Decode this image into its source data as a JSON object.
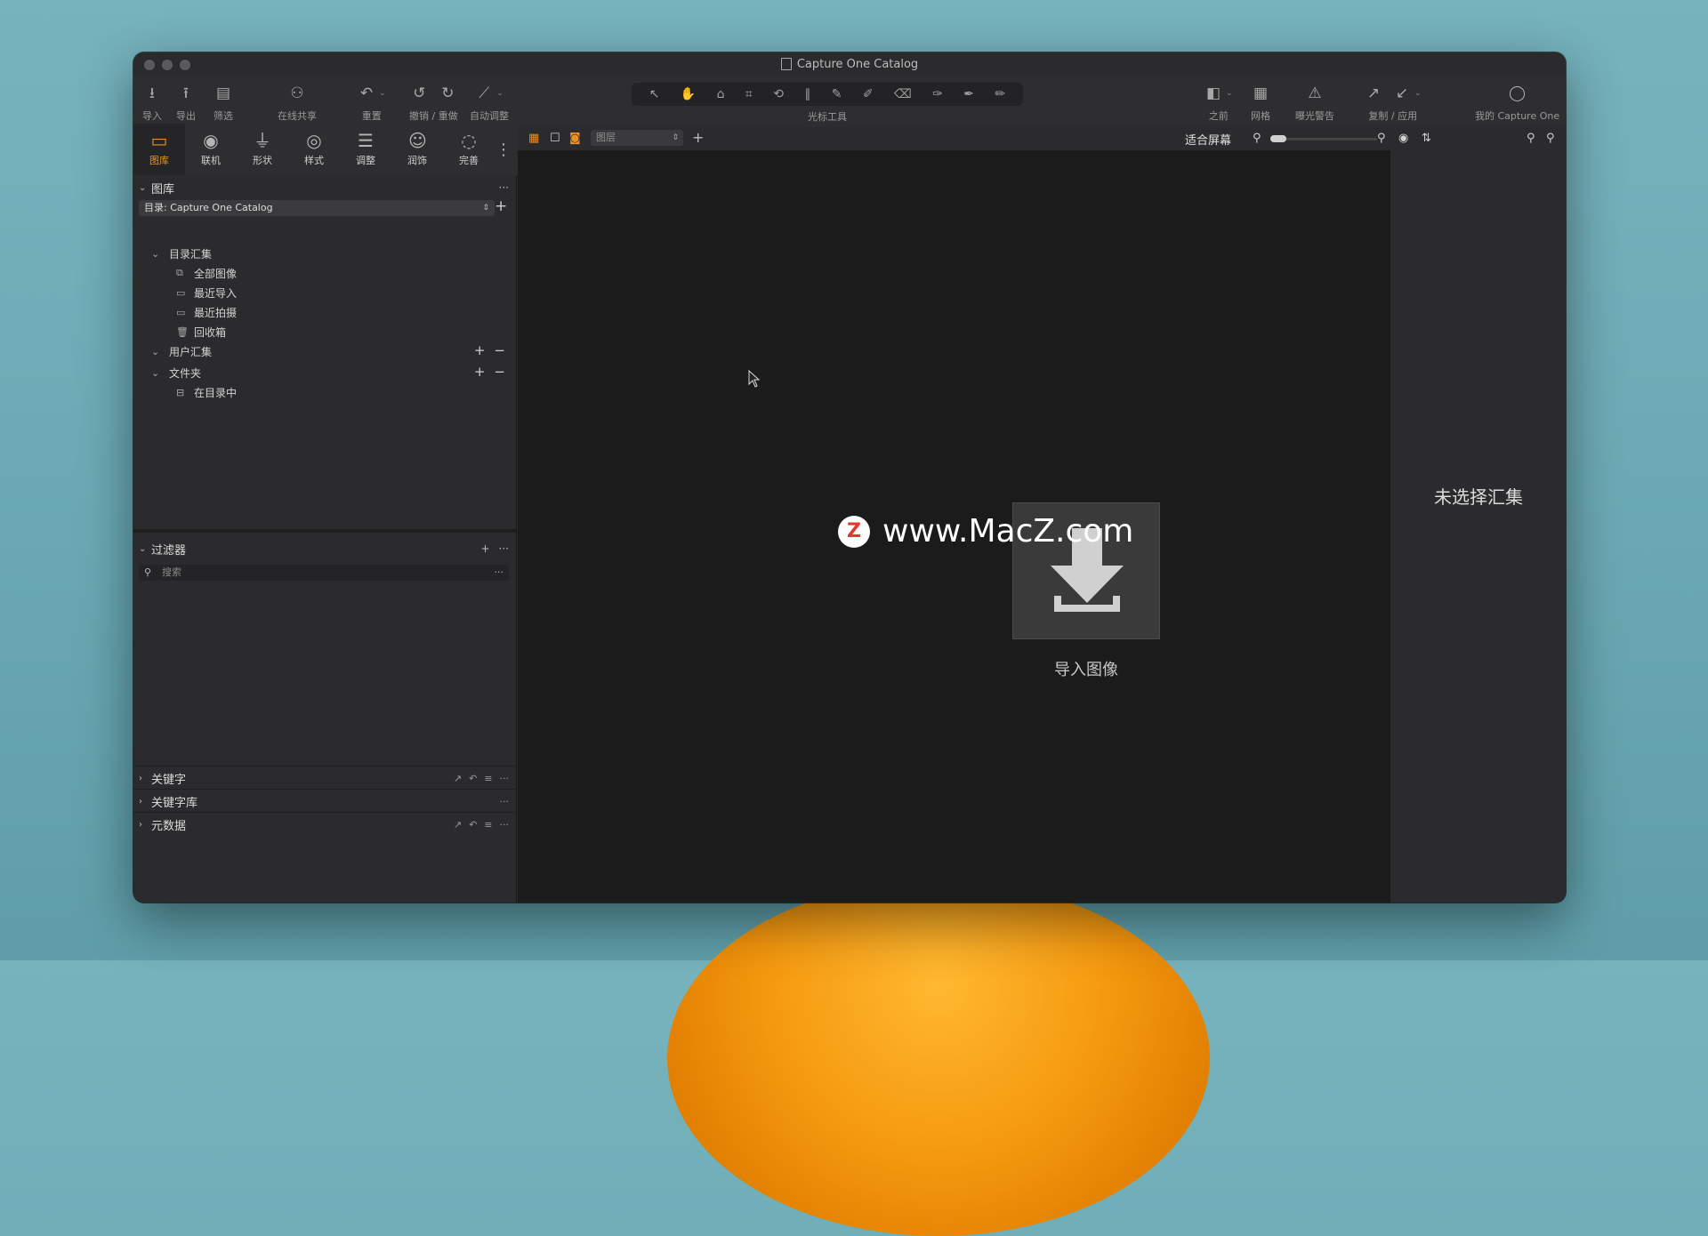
{
  "window": {
    "title": "Capture One Catalog"
  },
  "toolbar": {
    "import": "导入",
    "export": "导出",
    "filter": "筛选",
    "share": "在线共享",
    "reset": "重置",
    "undo_redo": "撤销 / 重做",
    "auto_adjust": "自动调整",
    "cursor_tools": "光标工具",
    "before": "之前",
    "grid": "网格",
    "exposure_warning": "曝光警告",
    "copy_apply": "复制 / 应用",
    "my_capture_one": "我的 Capture One"
  },
  "tabs": [
    {
      "label": "图库",
      "icon": "folder-icon"
    },
    {
      "label": "联机",
      "icon": "camera-icon"
    },
    {
      "label": "形状",
      "icon": "lens-icon"
    },
    {
      "label": "样式",
      "icon": "palette-icon"
    },
    {
      "label": "调整",
      "icon": "sliders-icon"
    },
    {
      "label": "润饰",
      "icon": "face-icon"
    },
    {
      "label": "完善",
      "icon": "circle-dashed-icon"
    }
  ],
  "library": {
    "title": "图库",
    "catalog_select": "目录: Capture One Catalog",
    "catalog_collections": "目录汇集",
    "all_images": "全部图像",
    "recent_imports": "最近导入",
    "recent_captures": "最近拍摄",
    "trash": "回收箱",
    "user_collections": "用户汇集",
    "folders": "文件夹",
    "in_catalog": "在目录中"
  },
  "filters": {
    "title": "过滤器",
    "search_placeholder": "搜索"
  },
  "bottom_sections": {
    "keywords": "关键字",
    "keyword_library": "关键字库",
    "metadata": "元数据"
  },
  "viewer": {
    "layer_select": "图层",
    "fit_screen": "适合屏幕",
    "import_images": "导入图像",
    "watermark": "www.MacZ.com",
    "watermark_logo": "Z"
  },
  "right_panel": {
    "no_collection": "未选择汇集"
  },
  "colors": {
    "accent": "#e8902a",
    "window_bg": "#2b2b2d",
    "viewer_bg": "#1b1b1b"
  }
}
